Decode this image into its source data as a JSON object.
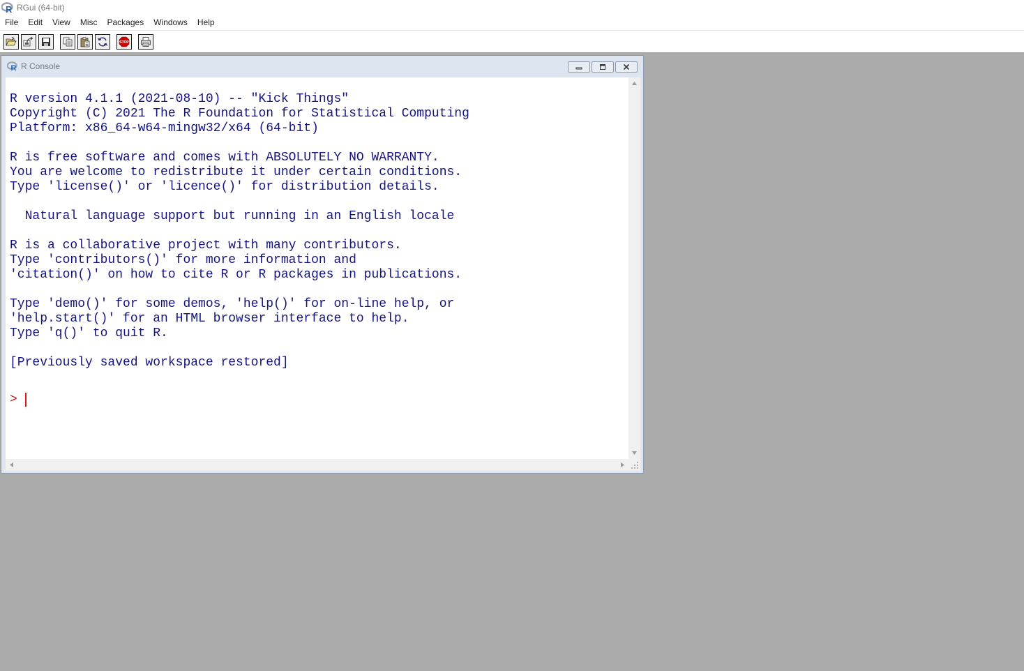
{
  "app": {
    "title": "RGui (64-bit)",
    "menu": [
      "File",
      "Edit",
      "View",
      "Misc",
      "Packages",
      "Windows",
      "Help"
    ]
  },
  "toolbar": {
    "buttons": [
      {
        "name": "open-script",
        "icon": "folder-open-icon"
      },
      {
        "name": "load-workspace",
        "icon": "load-workspace-icon"
      },
      {
        "name": "save-workspace",
        "icon": "save-icon"
      },
      {
        "name": "copy",
        "icon": "copy-icon"
      },
      {
        "name": "paste",
        "icon": "paste-icon"
      },
      {
        "name": "copy-paste",
        "icon": "refresh-icon"
      },
      {
        "name": "stop",
        "icon": "stop-icon"
      },
      {
        "name": "print",
        "icon": "print-icon"
      }
    ],
    "stop_label": "STOP"
  },
  "console": {
    "title": "R Console",
    "output": "\nR version 4.1.1 (2021-08-10) -- \"Kick Things\"\nCopyright (C) 2021 The R Foundation for Statistical Computing\nPlatform: x86_64-w64-mingw32/x64 (64-bit)\n\nR is free software and comes with ABSOLUTELY NO WARRANTY.\nYou are welcome to redistribute it under certain conditions.\nType 'license()' or 'licence()' for distribution details.\n\n  Natural language support but running in an English locale\n\nR is a collaborative project with many contributors.\nType 'contributors()' for more information and\n'citation()' on how to cite R or R packages in publications.\n\nType 'demo()' for some demos, 'help()' for on-line help, or\n'help.start()' for an HTML browser interface to help.\nType 'q()' to quit R.\n\n[Previously saved workspace restored]",
    "prompt": ">"
  },
  "colors": {
    "console_text": "#14147d",
    "prompt": "#d01818",
    "mdi_background": "#ababab"
  }
}
